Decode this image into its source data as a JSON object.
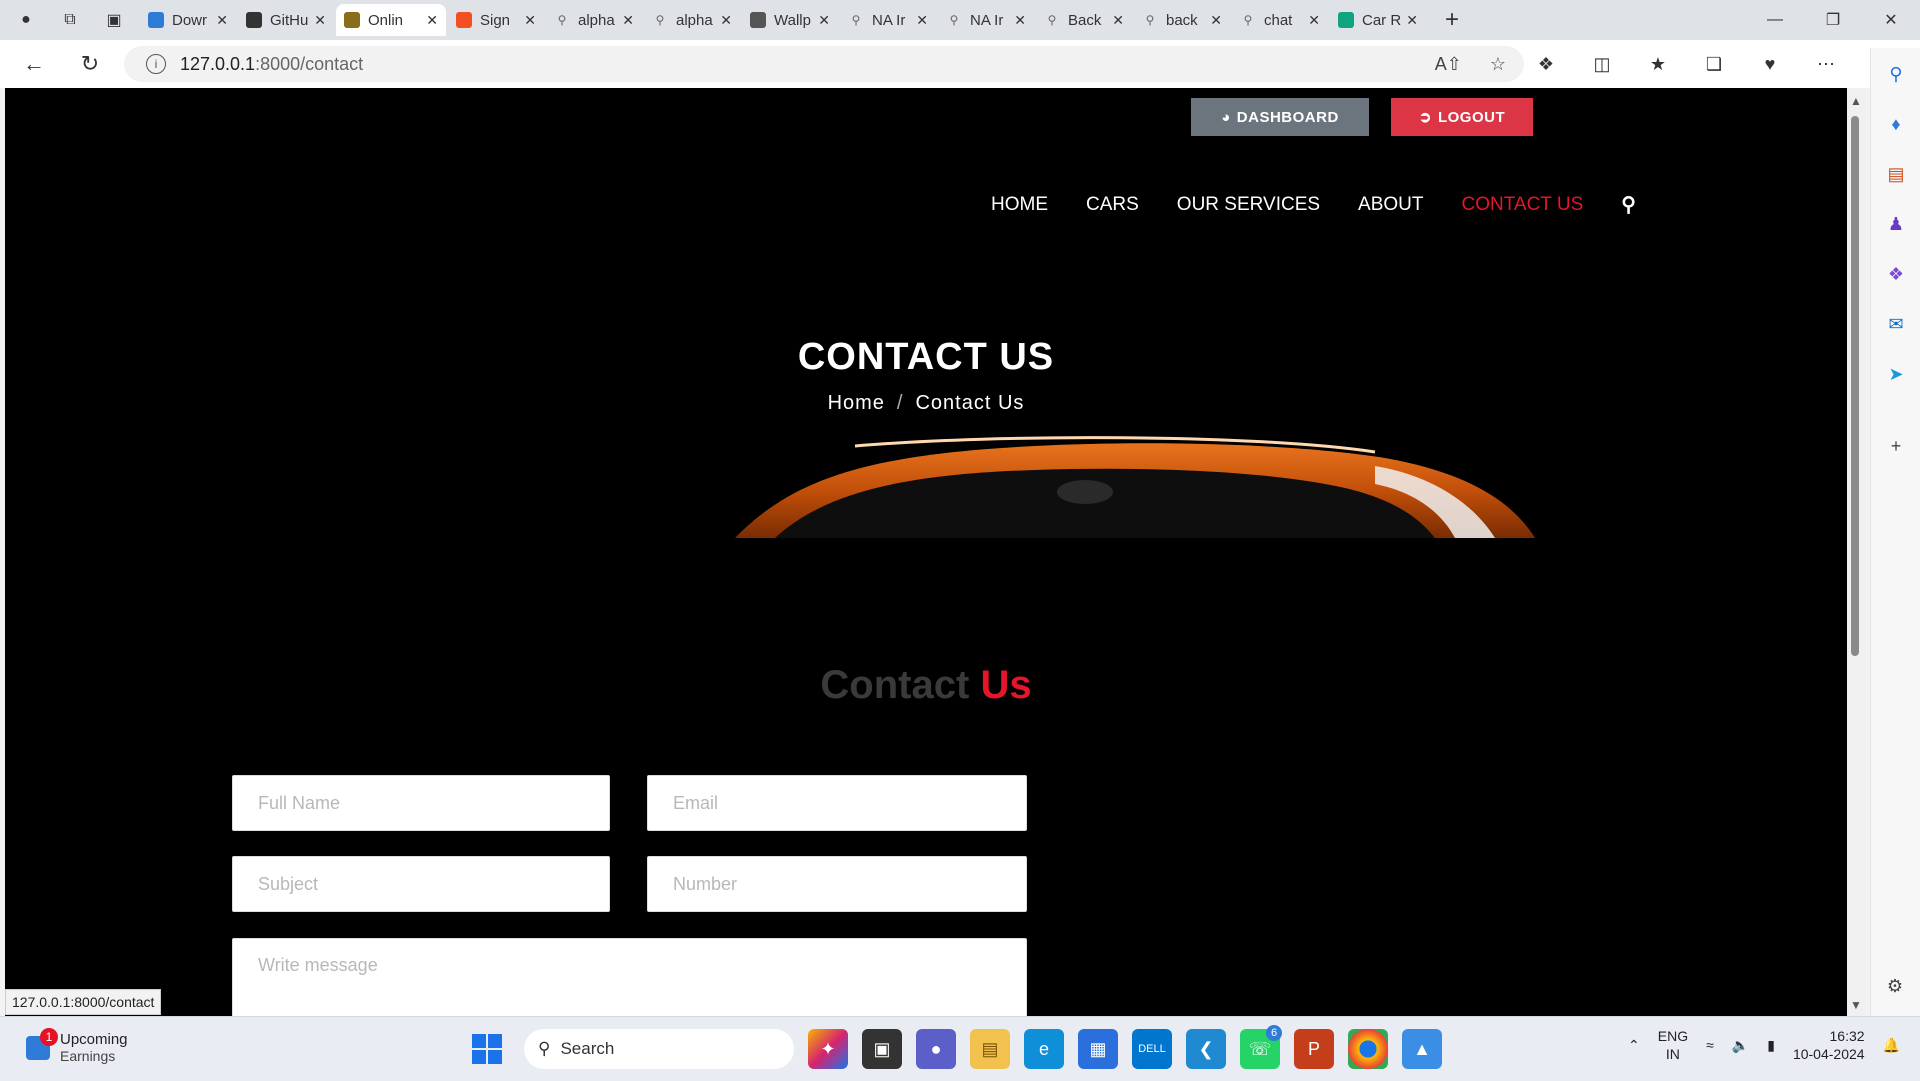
{
  "browser": {
    "tabs": [
      {
        "title": "Dowr",
        "icon": "vscode-icon",
        "color": "#2f7bd8"
      },
      {
        "title": "GitHu",
        "icon": "github-icon",
        "color": "#333333"
      },
      {
        "title": "Onlin",
        "icon": "site-icon",
        "color": "#8a6d1a"
      },
      {
        "title": "Sign",
        "icon": "microsoft-icon",
        "color": "#f25022"
      },
      {
        "title": "alpha",
        "icon": "search-icon",
        "color": "#777777"
      },
      {
        "title": "alpha",
        "icon": "search-icon",
        "color": "#777777"
      },
      {
        "title": "Wallp",
        "icon": "image-icon",
        "color": "#555555"
      },
      {
        "title": "NA Ir",
        "icon": "search-icon",
        "color": "#777777"
      },
      {
        "title": "NA Ir",
        "icon": "search-icon",
        "color": "#777777"
      },
      {
        "title": "Back",
        "icon": "search-icon",
        "color": "#777777"
      },
      {
        "title": "back",
        "icon": "search-icon",
        "color": "#777777"
      },
      {
        "title": "chat",
        "icon": "search-icon",
        "color": "#777777"
      },
      {
        "title": "Car R",
        "icon": "chatgpt-icon",
        "color": "#10a37f"
      }
    ],
    "active_tab_index": 2,
    "url_host": "127.0.0.1",
    "url_path": ":8000/contact",
    "status_url": "127.0.0.1:8000/contact"
  },
  "page": {
    "dashboard_label": "DASHBOARD",
    "logout_label": "LOGOUT",
    "nav": [
      "HOME",
      "CARS",
      "OUR SERVICES",
      "ABOUT",
      "CONTACT US"
    ],
    "active_nav_index": 4,
    "hero_title": "CONTACT US",
    "breadcrumb_home": "Home",
    "breadcrumb_sep": "/",
    "breadcrumb_current": "Contact Us",
    "section_title_a": "Contact",
    "section_title_b": "Us",
    "form": {
      "name_placeholder": "Full Name",
      "email_placeholder": "Email",
      "subject_placeholder": "Subject",
      "number_placeholder": "Number",
      "message_placeholder": "Write message"
    },
    "accent_color": "#e3162b"
  },
  "taskbar": {
    "weather_title": "Upcoming",
    "weather_sub": "Earnings",
    "weather_badge": "1",
    "search_label": "Search",
    "whatsapp_count": "6",
    "lang_top": "ENG",
    "lang_bottom": "IN",
    "time": "16:32",
    "date": "10-04-2024"
  }
}
